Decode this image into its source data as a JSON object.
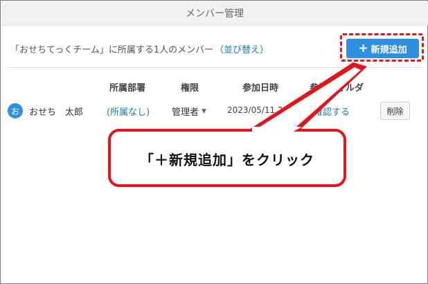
{
  "window": {
    "title": "メンバー管理"
  },
  "header": {
    "description": "「おせちてっくチーム」に所属する1人のメンバー",
    "reorder_link": "（並び替え）",
    "add_button": {
      "icon": "plus-icon",
      "label": "新規追加"
    }
  },
  "table": {
    "columns": [
      "所属部署",
      "権限",
      "参加日時",
      "参加フォルダ"
    ],
    "rows": [
      {
        "avatar_initial": "お",
        "name": "おせち　太郎",
        "department": "(所属なし)",
        "role": "管理者",
        "joined": "2023/05/11 22",
        "folder": "確認する",
        "delete": "削除"
      }
    ]
  },
  "callout": {
    "text": "「＋新規追加」をクリック",
    "color": "#e0161c"
  },
  "colors": {
    "accent": "#2f8fe0",
    "link": "#1a7fa8",
    "annotation": "#e0161c"
  }
}
